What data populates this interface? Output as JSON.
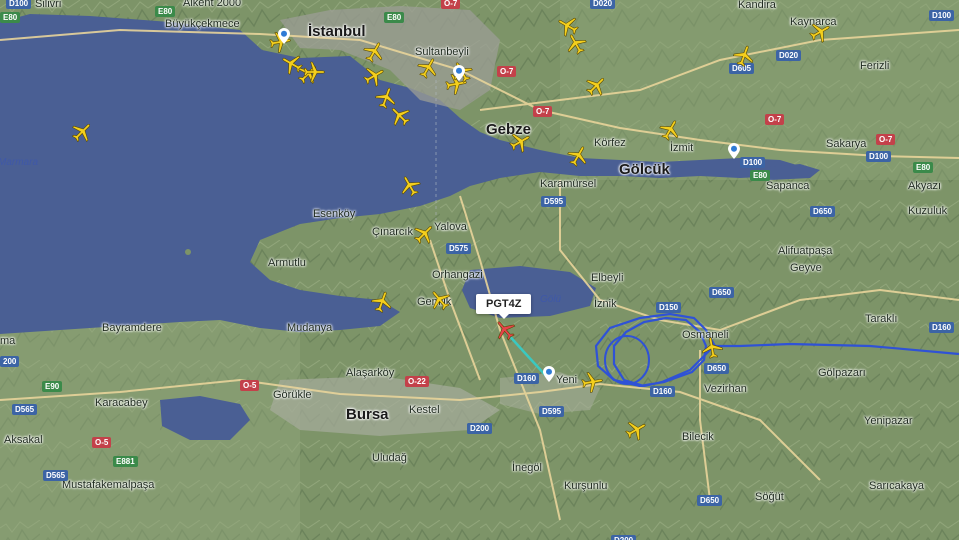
{
  "map": {
    "colors": {
      "water": "#4a5f94",
      "land": "#7d9468",
      "route": "#2f52d6",
      "trail": "#3bc8c0",
      "aircraft": "#f4cf1d",
      "selected_aircraft": "#e8424b"
    },
    "selected_flight": {
      "callsign": "PGT4Z"
    },
    "cities": [
      {
        "name": "İstanbul"
      },
      {
        "name": "Bursa"
      },
      {
        "name": "Gölcük"
      },
      {
        "name": "Gebze"
      }
    ],
    "towns": [
      {
        "name": "Silivri"
      },
      {
        "name": "Büyükçekmece"
      },
      {
        "name": "Sultanbeyli"
      },
      {
        "name": "Kandira"
      },
      {
        "name": "Kaynarca"
      },
      {
        "name": "Ferizli"
      },
      {
        "name": "Körfez"
      },
      {
        "name": "İzmit"
      },
      {
        "name": "Sakarya"
      },
      {
        "name": "Sapanca"
      },
      {
        "name": "Akyazı"
      },
      {
        "name": "Kuzuluk"
      },
      {
        "name": "Karamürsel"
      },
      {
        "name": "Çınarcık"
      },
      {
        "name": "Yalova"
      },
      {
        "name": "Esenköy"
      },
      {
        "name": "Armutlu"
      },
      {
        "name": "Orhangazi"
      },
      {
        "name": "Elbeyli"
      },
      {
        "name": "Alifuatpaşa"
      },
      {
        "name": "Geyve"
      },
      {
        "name": "Gemlik"
      },
      {
        "name": "İznik"
      },
      {
        "name": "Bayramdere"
      },
      {
        "name": "Mudanya"
      },
      {
        "name": "Osmaneli"
      },
      {
        "name": "Taraklı"
      },
      {
        "name": "Alaşarköy"
      },
      {
        "name": "Yeni"
      },
      {
        "name": "Vezirhan"
      },
      {
        "name": "Gölpazarı"
      },
      {
        "name": "Karacabey"
      },
      {
        "name": "Görükle"
      },
      {
        "name": "Kestel"
      },
      {
        "name": "Aksakal"
      },
      {
        "name": "Bilecik"
      },
      {
        "name": "Yenipazar"
      },
      {
        "name": "Mustafakemalpaşa"
      },
      {
        "name": "İnegöl"
      },
      {
        "name": "Kurşunlu"
      },
      {
        "name": "Söğüt"
      },
      {
        "name": "Sarıcakaya"
      },
      {
        "name": "Uludağ"
      }
    ],
    "water_labels": [
      {
        "name": "Marmara"
      },
      {
        "name": "Gölü"
      }
    ],
    "partial_labels": [
      {
        "name": "Alkent 2000"
      },
      {
        "name": "ma"
      }
    ],
    "road_labels": [
      {
        "text": "D100",
        "kind": "d"
      },
      {
        "text": "E80",
        "kind": "e"
      },
      {
        "text": "O-7",
        "kind": "o"
      },
      {
        "text": "E80",
        "kind": "e"
      },
      {
        "text": "E80",
        "kind": "e"
      },
      {
        "text": "O-7",
        "kind": "o"
      },
      {
        "text": "D020",
        "kind": "d"
      },
      {
        "text": "D605",
        "kind": "d"
      },
      {
        "text": "D020",
        "kind": "d"
      },
      {
        "text": "O-7",
        "kind": "o"
      },
      {
        "text": "O-7",
        "kind": "o"
      },
      {
        "text": "D100",
        "kind": "d"
      },
      {
        "text": "O-7",
        "kind": "o"
      },
      {
        "text": "D100",
        "kind": "d"
      },
      {
        "text": "E80",
        "kind": "e"
      },
      {
        "text": "E80",
        "kind": "e"
      },
      {
        "text": "D595",
        "kind": "d"
      },
      {
        "text": "D575",
        "kind": "d"
      },
      {
        "text": "D650",
        "kind": "d"
      },
      {
        "text": "D650",
        "kind": "d"
      },
      {
        "text": "D150",
        "kind": "d"
      },
      {
        "text": "D160",
        "kind": "d"
      },
      {
        "text": "D650",
        "kind": "d"
      },
      {
        "text": "D160",
        "kind": "d"
      },
      {
        "text": "D160",
        "kind": "d"
      },
      {
        "text": "D595",
        "kind": "d"
      },
      {
        "text": "O-22",
        "kind": "o"
      },
      {
        "text": "D160",
        "kind": "d"
      },
      {
        "text": "O-5",
        "kind": "o"
      },
      {
        "text": "E90",
        "kind": "e"
      },
      {
        "text": "200",
        "kind": "d"
      },
      {
        "text": "D565",
        "kind": "d"
      },
      {
        "text": "O-5",
        "kind": "o"
      },
      {
        "text": "E881",
        "kind": "e"
      },
      {
        "text": "D565",
        "kind": "d"
      },
      {
        "text": "D200",
        "kind": "d"
      },
      {
        "text": "D650",
        "kind": "d"
      },
      {
        "text": "D200",
        "kind": "d"
      },
      {
        "text": "D100",
        "kind": "d"
      }
    ]
  }
}
